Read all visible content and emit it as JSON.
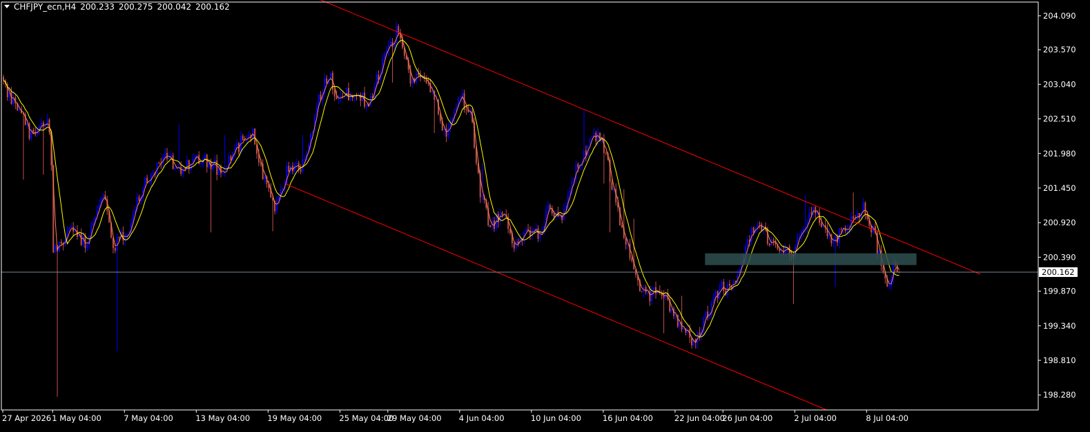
{
  "header": {
    "symbol": "CHFJPY_ecn,H4",
    "open": "200.233",
    "high": "200.275",
    "low": "200.042",
    "close": "200.162"
  },
  "colors": {
    "background": "#000000",
    "frame": "#ffffff",
    "bull_candle": "#0000ff",
    "bear_candle": "#c0504d",
    "fast_ma": "#ff7f50",
    "slow_ma": "#ffff00",
    "channel": "#ff0000",
    "zone": "#2f4f4f",
    "price_line": "#778899"
  },
  "chart_data": {
    "type": "candlestick",
    "grid": false,
    "ylim": [
      198.05,
      204.3
    ],
    "y_ticks": [
      "204.090",
      "203.570",
      "203.040",
      "202.510",
      "201.980",
      "201.450",
      "200.920",
      "200.390",
      "199.870",
      "199.340",
      "198.810",
      "198.280"
    ],
    "x_ticks": [
      {
        "label": "27 Apr 2026",
        "bar": 0
      },
      {
        "label": "1 May 04:00",
        "bar": 25
      },
      {
        "label": "7 May 04:00",
        "bar": 61
      },
      {
        "label": "13 May 04:00",
        "bar": 97
      },
      {
        "label": "19 May 04:00",
        "bar": 133
      },
      {
        "label": "25 May 04:00",
        "bar": 169
      },
      {
        "label": "29 May 04:00",
        "bar": 193
      },
      {
        "label": "4 Jun 04:00",
        "bar": 229
      },
      {
        "label": "10 Jun 04:00",
        "bar": 265
      },
      {
        "label": "16 Jun 04:00",
        "bar": 301
      },
      {
        "label": "22 Jun 04:00",
        "bar": 337
      },
      {
        "label": "26 Jun 04:00",
        "bar": 361
      },
      {
        "label": "2 Jul 04:00",
        "bar": 397
      },
      {
        "label": "8 Jul 04:00",
        "bar": 433
      }
    ],
    "anchors": [
      [
        0,
        203.05
      ],
      [
        8,
        202.6
      ],
      [
        15,
        202.2
      ],
      [
        22,
        202.55
      ],
      [
        24,
        201.9
      ],
      [
        25,
        200.5
      ],
      [
        33,
        200.8
      ],
      [
        42,
        200.6
      ],
      [
        50,
        201.4
      ],
      [
        55,
        200.55
      ],
      [
        63,
        200.85
      ],
      [
        70,
        201.5
      ],
      [
        80,
        201.95
      ],
      [
        90,
        201.75
      ],
      [
        100,
        201.9
      ],
      [
        110,
        201.7
      ],
      [
        120,
        202.2
      ],
      [
        125,
        202.3
      ],
      [
        130,
        201.6
      ],
      [
        136,
        201.2
      ],
      [
        142,
        201.7
      ],
      [
        150,
        201.8
      ],
      [
        158,
        202.8
      ],
      [
        163,
        203.2
      ],
      [
        168,
        202.8
      ],
      [
        176,
        202.95
      ],
      [
        183,
        202.7
      ],
      [
        190,
        203.4
      ],
      [
        198,
        203.9
      ],
      [
        204,
        203.1
      ],
      [
        210,
        203.2
      ],
      [
        216,
        202.8
      ],
      [
        222,
        202.2
      ],
      [
        228,
        202.9
      ],
      [
        234,
        202.6
      ],
      [
        239,
        201.4
      ],
      [
        244,
        200.85
      ],
      [
        250,
        201.1
      ],
      [
        256,
        200.6
      ],
      [
        262,
        200.85
      ],
      [
        268,
        200.7
      ],
      [
        274,
        201.2
      ],
      [
        280,
        200.9
      ],
      [
        285,
        201.6
      ],
      [
        292,
        202.0
      ],
      [
        298,
        202.3
      ],
      [
        303,
        201.8
      ],
      [
        307,
        201.2
      ],
      [
        312,
        200.6
      ],
      [
        318,
        200.0
      ],
      [
        324,
        199.8
      ],
      [
        330,
        199.9
      ],
      [
        336,
        199.5
      ],
      [
        342,
        199.25
      ],
      [
        347,
        199.05
      ],
      [
        351,
        199.4
      ],
      [
        356,
        199.7
      ],
      [
        360,
        200.0
      ],
      [
        364,
        199.85
      ],
      [
        368,
        200.1
      ],
      [
        373,
        200.6
      ],
      [
        378,
        201.0
      ],
      [
        383,
        200.7
      ],
      [
        389,
        200.55
      ],
      [
        395,
        200.4
      ],
      [
        401,
        200.8
      ],
      [
        406,
        201.2
      ],
      [
        410,
        200.95
      ],
      [
        415,
        200.6
      ],
      [
        420,
        200.8
      ],
      [
        426,
        201.0
      ],
      [
        431,
        201.15
      ],
      [
        436,
        200.8
      ],
      [
        440,
        200.25
      ],
      [
        443,
        199.95
      ],
      [
        446,
        200.2
      ],
      [
        449,
        200.16
      ]
    ],
    "series": [
      {
        "type": "candles",
        "bars": 450
      },
      {
        "type": "ma",
        "period": 3
      },
      {
        "type": "ma",
        "period": 8
      }
    ],
    "channel": {
      "upper": {
        "from": {
          "bar": 158,
          "price": 204.35
        },
        "to": {
          "bar": 490,
          "price": 200.13
        }
      },
      "lower": {
        "from": {
          "bar": 142,
          "price": 201.51
        },
        "to": {
          "bar": 413,
          "price": 198.05
        }
      }
    },
    "zone": {
      "from_bar": 352,
      "to_bar": 458,
      "top": 200.45,
      "bottom": 200.27
    },
    "current_price": {
      "value": 200.162,
      "label": "200.162"
    }
  }
}
